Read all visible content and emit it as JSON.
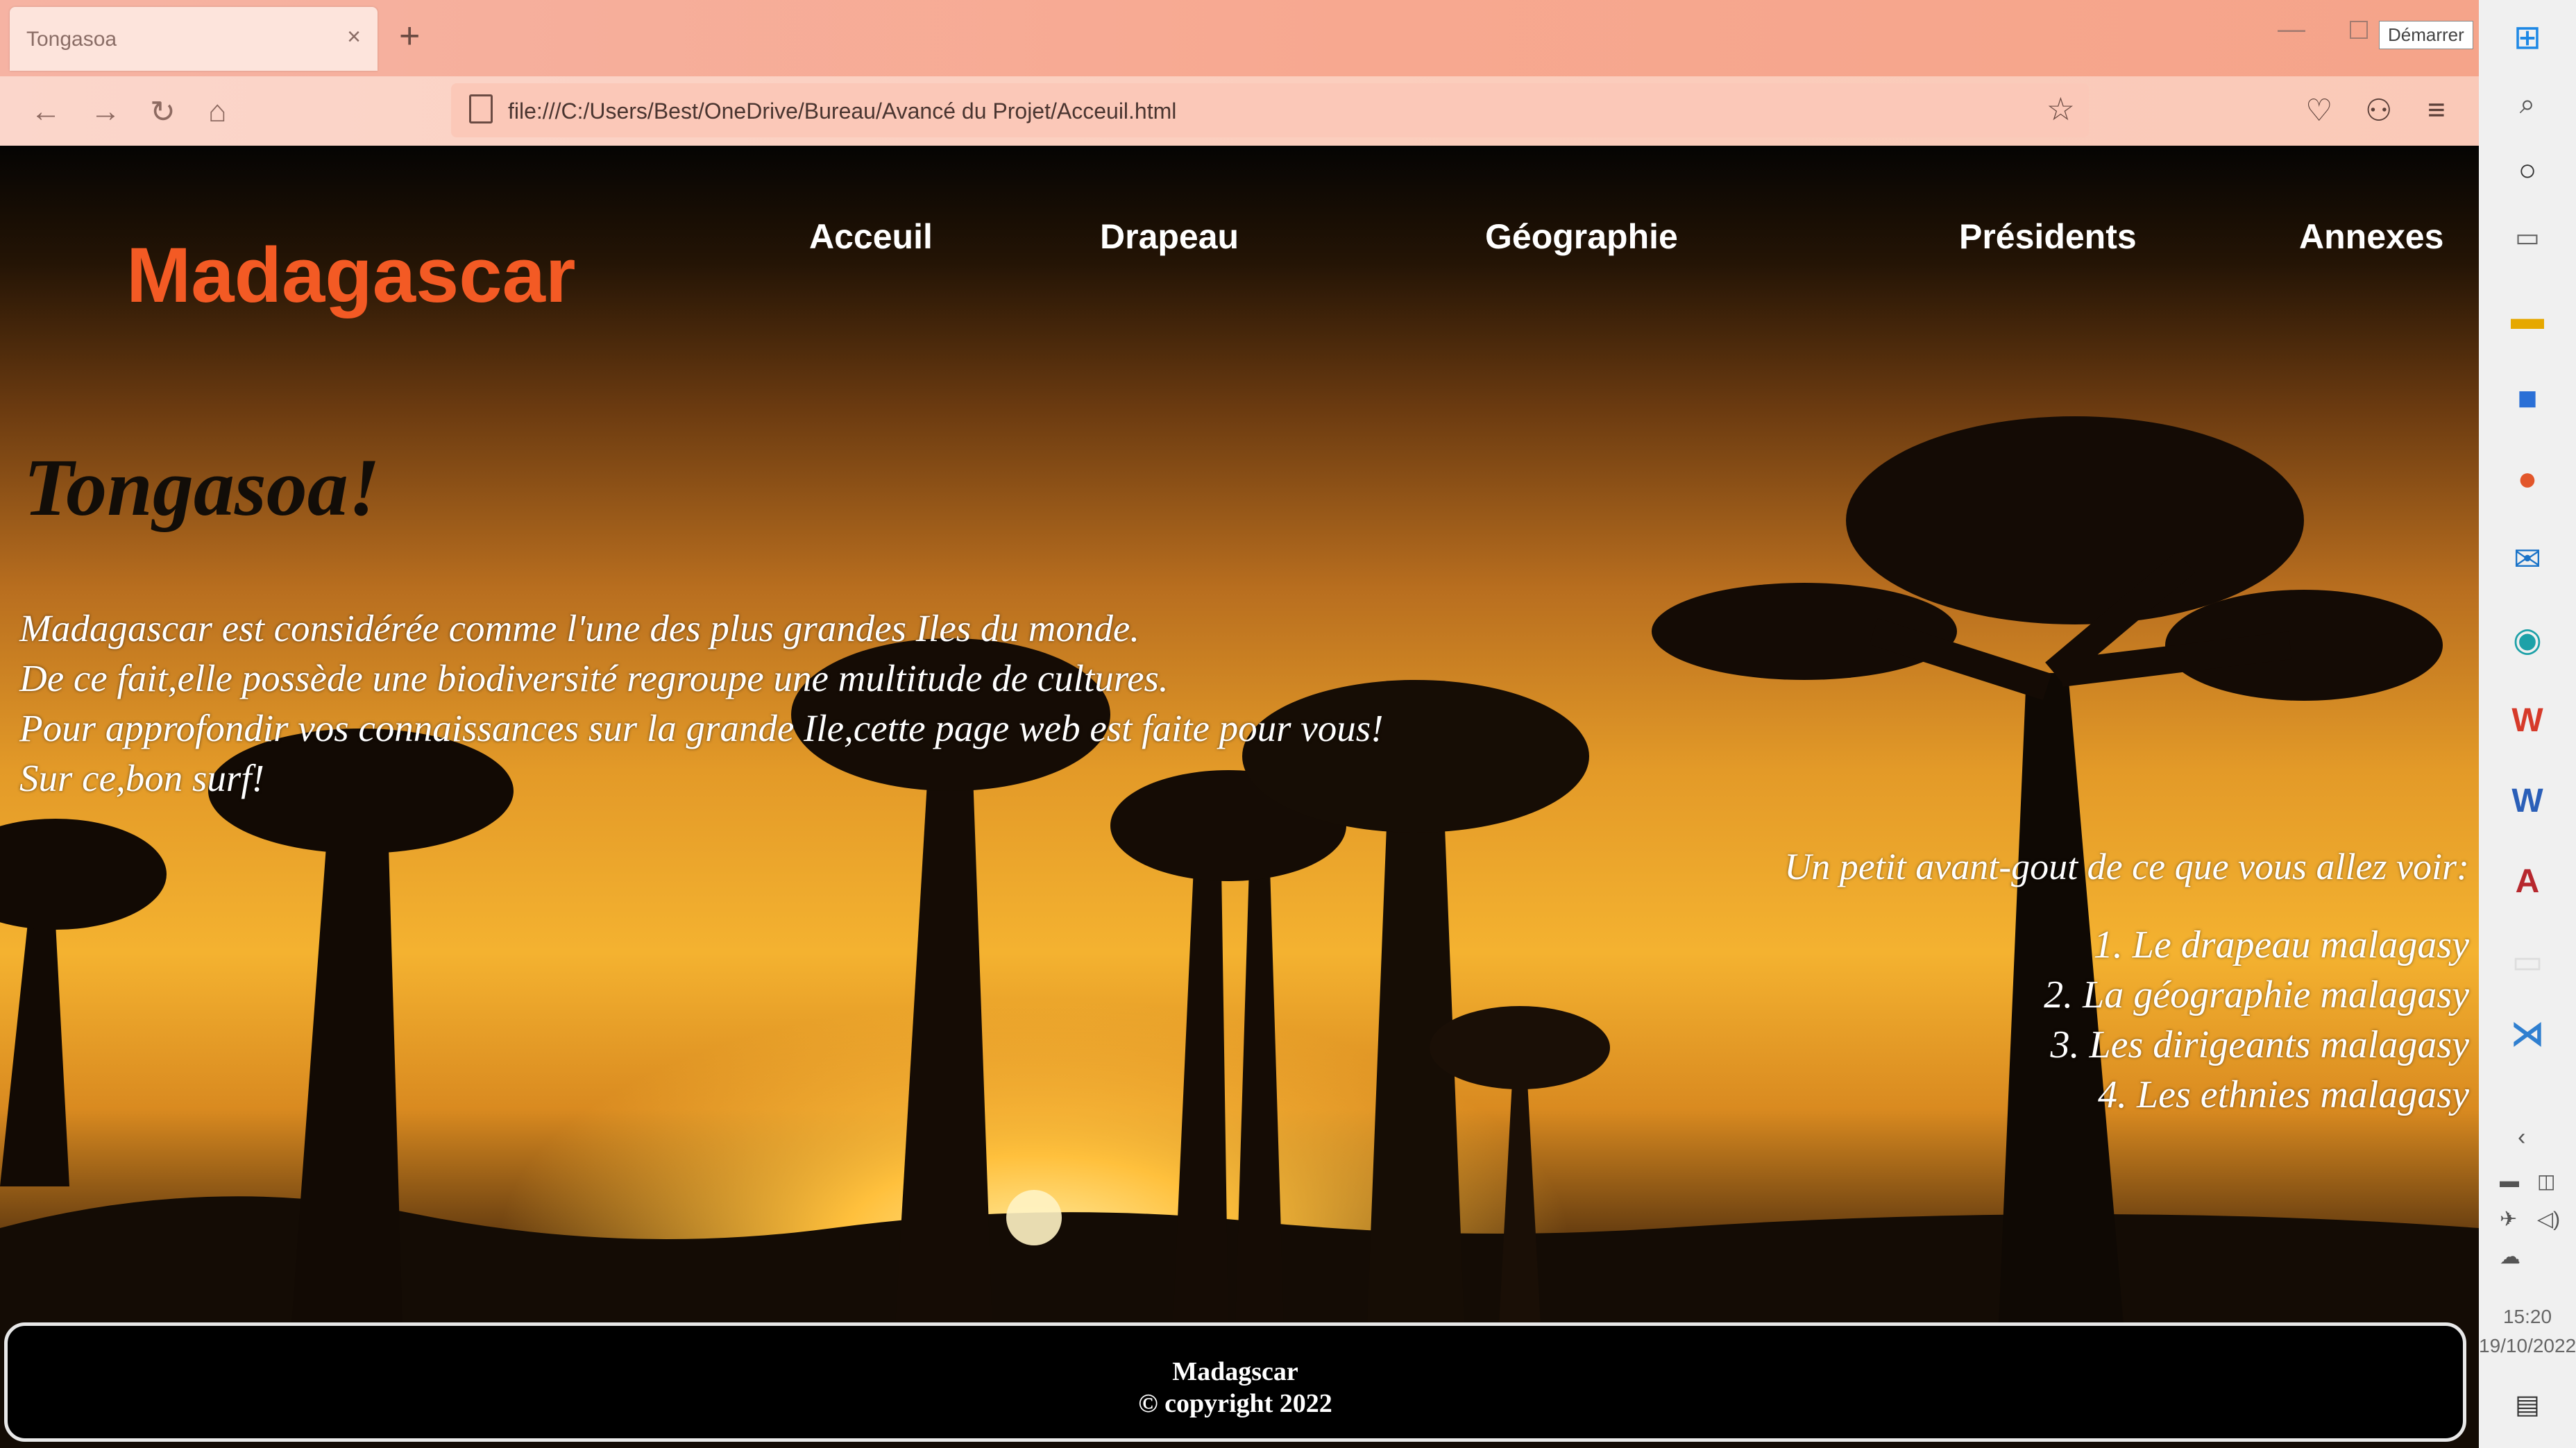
{
  "browser": {
    "tab_title": "Tongasoa",
    "tab_close": "×",
    "new_tab": "+",
    "window_min": "—",
    "demarrer_tooltip": "Démarrer",
    "url": "file:///C:/Users/Best/OneDrive/Bureau/Avancé du Projet/Acceuil.html",
    "back_icon": "←",
    "forward_icon": "→",
    "reload_icon": "↻",
    "home_icon": "⌂",
    "star_icon": "☆",
    "pocket_icon": "♡",
    "extensions_icon": "⚇",
    "menu_icon": "≡"
  },
  "site": {
    "brand": "Madagascar",
    "menu": [
      "Acceuil",
      "Drapeau",
      "Géographie",
      "Présidents",
      "Annexes"
    ]
  },
  "content": {
    "heading": "Tongasoa!",
    "intro": [
      "Madagascar est considérée comme l'une des plus grandes Iles du monde.",
      "De ce fait,elle possède une biodiversité regroupe une multitude de cultures.",
      "Pour approfondir vos connaissances sur la grande Ile,cette page web est faite pour vous!",
      "Sur ce,bon surf!"
    ],
    "preview_title": "Un petit avant-gout de ce que vous allez voir:",
    "preview_items": [
      "1. Le drapeau malagasy",
      "2. La géographie malagasy",
      "3. Les dirigeants malagasy",
      "4. Les ethnies malagasy"
    ]
  },
  "footer": {
    "name": "Madagscar",
    "copyright": "© copyright 2022"
  },
  "taskbar": {
    "time": "15:20",
    "date": "19/10/2022"
  },
  "colors": {
    "brand": "#f35a24",
    "tab_bar": "#f7a890",
    "sky_sunset": "#f4b230"
  }
}
